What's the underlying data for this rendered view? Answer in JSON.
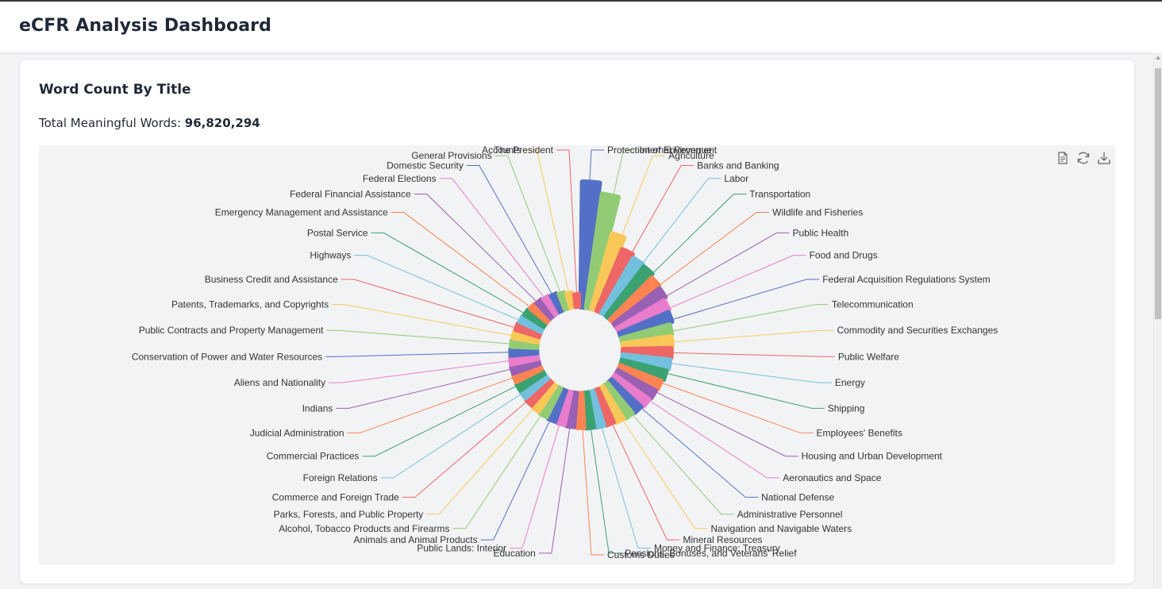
{
  "app": {
    "title": "eCFR Analysis Dashboard"
  },
  "card": {
    "title": "Word Count By Title",
    "total_label": "Total Meaningful Words:",
    "total_value": "96,820,294"
  },
  "toolbox": [
    {
      "name": "data-view-icon",
      "tooltip": "Data View"
    },
    {
      "name": "restore-icon",
      "tooltip": "Restore"
    },
    {
      "name": "save-image-icon",
      "tooltip": "Save as Image"
    }
  ],
  "colors": [
    "#5470c6",
    "#91cc75",
    "#fac858",
    "#ee6666",
    "#73c0de",
    "#3ba272",
    "#fc8452",
    "#9a60b4",
    "#ea7ccc"
  ],
  "chart_data": {
    "type": "bar",
    "subtype": "nightingale-rose",
    "categories": [
      "Protection of Environment",
      "Internal Revenue",
      "Agriculture",
      "Banks and Banking",
      "Labor",
      "Transportation",
      "Wildlife and Fisheries",
      "Public Health",
      "Food and Drugs",
      "Federal Acquisition Regulations System",
      "Telecommunication",
      "Commodity and Securities Exchanges",
      "Public Welfare",
      "Energy",
      "Shipping",
      "Employees' Benefits",
      "Housing and Urban Development",
      "Aeronautics and Space",
      "National Defense",
      "Administrative Personnel",
      "Navigation and Navigable Waters",
      "Mineral Resources",
      "Money and Finance: Treasury",
      "Pensions, Bonuses, and Veterans' Relief",
      "Customs Duties",
      "Education",
      "Public Lands: Interior",
      "Animals and Animal Products",
      "Alcohol, Tobacco Products and Firearms",
      "Parks, Forests, and Public Property",
      "Commerce and Foreign Trade",
      "Foreign Relations",
      "Commercial Practices",
      "Judicial Administration",
      "Indians",
      "Aliens and Nationality",
      "Conservation of Power and Water Resources",
      "Public Contracts and Property Management",
      "Patents, Trademarks, and Copyrights",
      "Business Credit and Assistance",
      "Highways",
      "Postal Service",
      "Emergency Management and Assistance",
      "Federal Financial Assistance",
      "Federal Elections",
      "Domestic Security",
      "General Provisions",
      "Accounts",
      "The President"
    ],
    "values": [
      20500000,
      16900000,
      7100000,
      4900000,
      4400000,
      4200000,
      3700000,
      3500000,
      3100000,
      2900000,
      2500000,
      2400000,
      2300000,
      2200000,
      2000000,
      1800000,
      1700000,
      1600000,
      1450000,
      1350000,
      1250000,
      1150000,
      1100000,
      1050000,
      1000000,
      950000,
      900000,
      850000,
      800000,
      750000,
      700000,
      650000,
      620000,
      580000,
      550000,
      520000,
      480000,
      450000,
      420000,
      380000,
      340000,
      300000,
      260000,
      220000,
      180000,
      140000,
      100000,
      60000,
      25000
    ]
  }
}
